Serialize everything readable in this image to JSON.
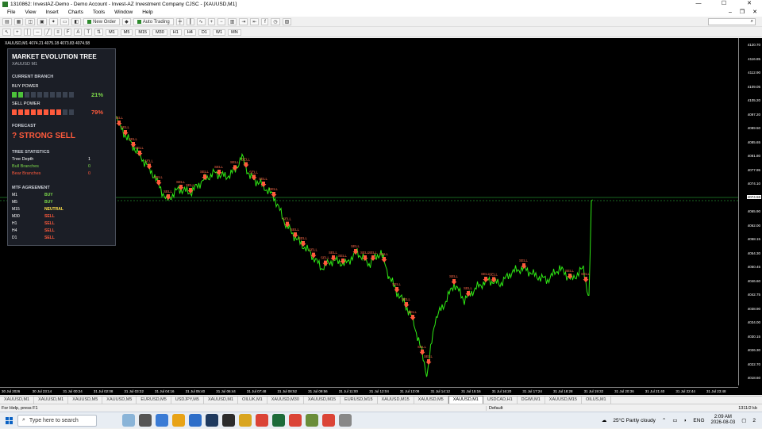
{
  "window": {
    "title": "1310862: InvestAZ-Demo - Demo Account - Invest-AZ Investment Company CJSC - [XAUUSD,M1]",
    "controls": [
      "—",
      "☐",
      "✕"
    ]
  },
  "menu": [
    "File",
    "View",
    "Insert",
    "Charts",
    "Tools",
    "Window",
    "Help"
  ],
  "toolbar": {
    "new_order": "New Order",
    "auto_trading": "Auto Trading",
    "timeframes": [
      "M1",
      "M5",
      "M15",
      "M30",
      "H1",
      "H4",
      "D1",
      "W1",
      "MN"
    ]
  },
  "chart": {
    "header": "XAUUSD,M1  4074.21 4075.18 4073.83 4074.58",
    "current_price": "4074.58",
    "y_ticks": [
      "4120.70",
      "4116.85",
      "4112.90",
      "4109.05",
      "4105.20",
      "4097.20",
      "4089.50",
      "4085.65",
      "4081.80",
      "4077.95",
      "4074.10",
      "4069.00",
      "4065.90",
      "4062.00",
      "4058.15",
      "4054.30",
      "4050.45",
      "4046.60",
      "4042.75",
      "4038.90",
      "4034.00",
      "4030.15",
      "4026.30",
      "4022.70",
      "4018.60"
    ],
    "x_ticks": [
      "30 Jul 2026",
      "30 Jul 23:14",
      "31 Jul 00:24",
      "31 Jul 02:08",
      "31 Jul 03:32",
      "31 Jul 04:16",
      "31 Jul 05:40",
      "31 Jul 06:44",
      "31 Jul 07:48",
      "31 Jul 08:52",
      "31 Jul 09:56",
      "31 Jul 11:00",
      "31 Jul 12:04",
      "31 Jul 13:08",
      "31 Jul 14:12",
      "31 Jul 15:16",
      "31 Jul 16:20",
      "31 Jul 17:24",
      "31 Jul 18:28",
      "31 Jul 19:32",
      "31 Jul 20:36",
      "31 Jul 21:40",
      "31 Jul 22:44",
      "31 Jul 23:48"
    ],
    "signal_label": "SELL"
  },
  "panel": {
    "title": "MARKET EVOLUTION TREE",
    "symbol": "XAUUSD  M1",
    "current_branch": "CURRENT BRANCH",
    "buy_power_label": "BUY POWER",
    "buy_power_pct": "21%",
    "buy_power_value": 0.21,
    "sell_power_label": "SELL POWER",
    "sell_power_pct": "79%",
    "sell_power_value": 0.79,
    "forecast_label": "FORECAST",
    "forecast_value": "? STRONG SELL",
    "stats_label": "TREE STATISTICS",
    "stats": [
      {
        "label": "Tree Depth",
        "value": "1",
        "color": "#ffffff"
      },
      {
        "label": "Bull Branches",
        "value": "0",
        "color": "#7cd84a"
      },
      {
        "label": "Bear Branches",
        "value": "0",
        "color": "#ff5a3c"
      }
    ],
    "mtf_label": "MTF AGREEMENT",
    "mtf": [
      {
        "tf": "M1",
        "signal": "BUY",
        "cls": "buy"
      },
      {
        "tf": "M5",
        "signal": "BUY",
        "cls": "buy"
      },
      {
        "tf": "M15",
        "signal": "NEUTRAL",
        "cls": "neutral"
      },
      {
        "tf": "M30",
        "signal": "SELL",
        "cls": "sell"
      },
      {
        "tf": "H1",
        "signal": "SELL",
        "cls": "sell"
      },
      {
        "tf": "H4",
        "signal": "SELL",
        "cls": "sell"
      },
      {
        "tf": "D1",
        "signal": "SELL",
        "cls": "sell"
      }
    ]
  },
  "tabs": [
    "XAUUSD,M1",
    "XAUUSD,M1",
    "XAUUSD,M5",
    "XAUUSD,M5",
    "EURUSD,M5",
    "USDJPY,M5",
    "XAUUSD,M1",
    "OILUK,M1",
    "XAUUSD,M30",
    "XAUUSD,M15",
    "EURUSD,M15",
    "XAUUSD,M15",
    "XAUUSD,M5",
    "XAUUSD,M1",
    "USDCAD,H1",
    "DGWI,M1",
    "XAUUSD,M15",
    "OILUS,M1"
  ],
  "active_tab": 13,
  "status": {
    "help": "For Help, press F1",
    "profile": "Default",
    "traffic": "1311/2 kb"
  },
  "taskbar": {
    "search_placeholder": "Type here to search",
    "weather": "25°C  Partly cloudy",
    "lang": "ENG",
    "time": "2:09 AM",
    "date": "2026-08-03",
    "notifications": "2"
  }
}
